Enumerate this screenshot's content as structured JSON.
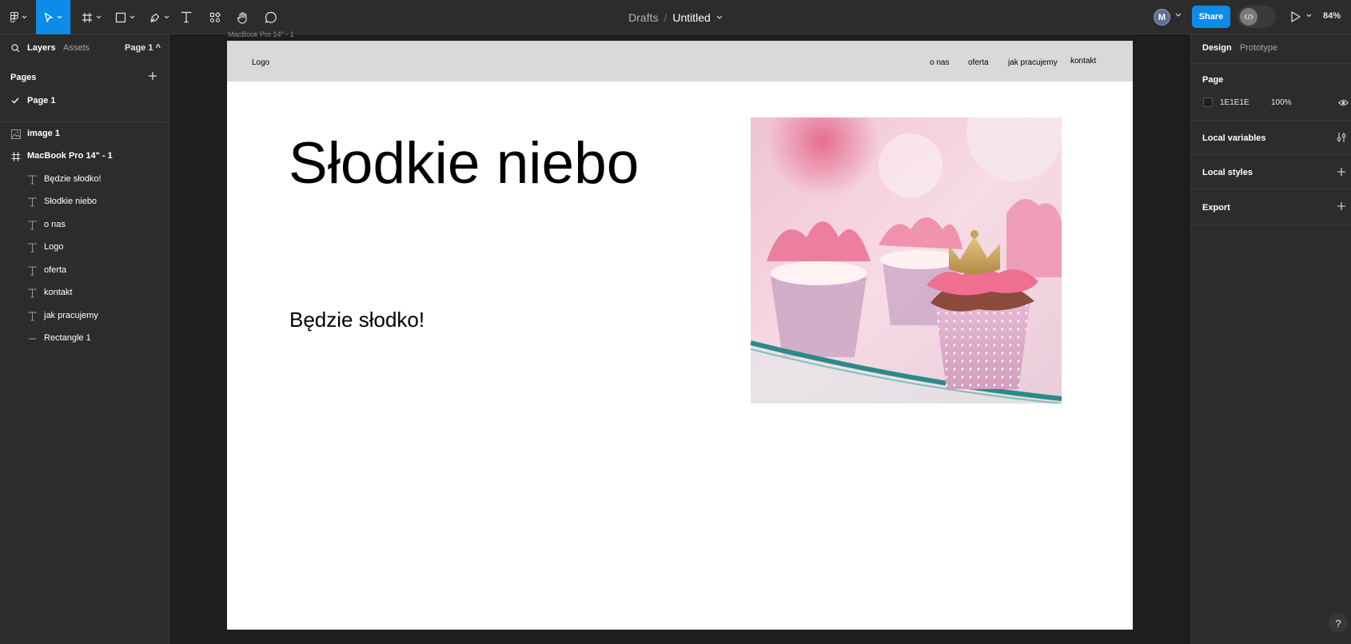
{
  "toolbar": {
    "breadcrumb": {
      "folder": "Drafts",
      "separator": "/",
      "file": "Untitled"
    },
    "avatar_initial": "M",
    "share_label": "Share",
    "zoom": "84%",
    "accent_color": "#0c8ce9"
  },
  "left_panel": {
    "tabs": {
      "layers": "Layers",
      "assets": "Assets"
    },
    "page_selector": "Page 1 ^",
    "pages_heading": "Pages",
    "pages": [
      {
        "label": "Page 1",
        "selected": true
      }
    ],
    "layers": [
      {
        "name": "image 1",
        "icon": "image-icon"
      },
      {
        "name": "MacBook Pro 14\" - 1",
        "icon": "frame-icon"
      },
      {
        "name": "Będzie słodko!",
        "icon": "text-icon"
      },
      {
        "name": "Słodkie niebo",
        "icon": "text-icon"
      },
      {
        "name": "o nas",
        "icon": "text-icon"
      },
      {
        "name": "Logo",
        "icon": "text-icon"
      },
      {
        "name": "oferta",
        "icon": "text-icon"
      },
      {
        "name": "kontakt",
        "icon": "text-icon"
      },
      {
        "name": "jak pracujemy",
        "icon": "text-icon"
      },
      {
        "name": "Rectangle 1",
        "icon": "line-icon"
      }
    ]
  },
  "right_panel": {
    "tabs": {
      "design": "Design",
      "prototype": "Prototype"
    },
    "page_section": {
      "title": "Page",
      "color_hex": "1E1E1E",
      "opacity": "100%"
    },
    "sections": [
      {
        "title": "Local variables",
        "icon": "variables-icon"
      },
      {
        "title": "Local styles",
        "icon": "plus-icon"
      },
      {
        "title": "Export",
        "icon": "plus-icon"
      }
    ],
    "help": "?"
  },
  "canvas": {
    "frame_label": "MacBook Pro 14\" - 1",
    "frame": {
      "logo": "Logo",
      "nav_links": [
        "o nas",
        "oferta",
        "jak pracujemy",
        "kontakt"
      ],
      "title": "Słodkie niebo",
      "subtitle": "Będzie słodko!"
    }
  }
}
